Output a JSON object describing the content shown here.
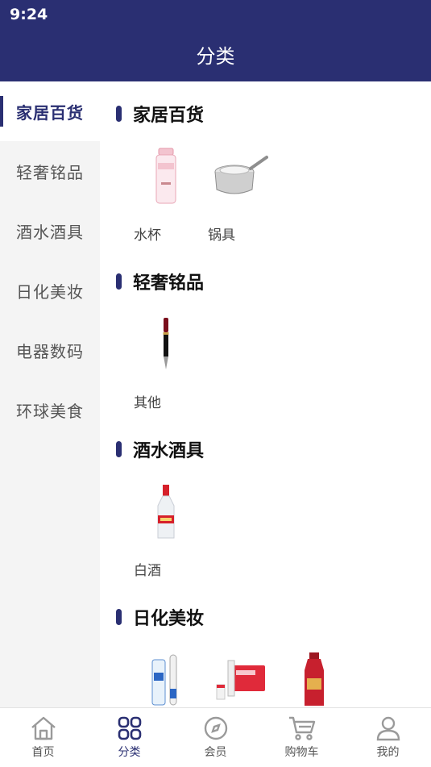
{
  "status_bar": {
    "time": "9:24"
  },
  "header": {
    "title": "分类"
  },
  "sidebar": {
    "items": [
      {
        "label": "家居百货",
        "active": true
      },
      {
        "label": "轻奢铭品",
        "active": false
      },
      {
        "label": "酒水酒具",
        "active": false
      },
      {
        "label": "日化美妆",
        "active": false
      },
      {
        "label": "电器数码",
        "active": false
      },
      {
        "label": "环球美食",
        "active": false
      }
    ]
  },
  "sections": [
    {
      "title": "家居百货",
      "items": [
        {
          "label": "水杯",
          "icon": "water-bottle"
        },
        {
          "label": "锅具",
          "icon": "stainless-pot"
        }
      ]
    },
    {
      "title": "轻奢铭品",
      "items": [
        {
          "label": "其他",
          "icon": "fountain-pen"
        }
      ]
    },
    {
      "title": "酒水酒具",
      "items": [
        {
          "label": "白酒",
          "icon": "liquor-bottle"
        }
      ]
    },
    {
      "title": "日化美妆",
      "items": [
        {
          "label": "",
          "icon": "toothpaste-brush"
        },
        {
          "label": "",
          "icon": "skincare-set"
        },
        {
          "label": "",
          "icon": "shampoo-bottle"
        }
      ]
    }
  ],
  "tabbar": {
    "tabs": [
      {
        "label": "首页",
        "icon": "home-icon",
        "active": false
      },
      {
        "label": "分类",
        "icon": "grid-icon",
        "active": true
      },
      {
        "label": "会员",
        "icon": "compass-icon",
        "active": false
      },
      {
        "label": "购物车",
        "icon": "cart-icon",
        "active": false
      },
      {
        "label": "我的",
        "icon": "user-icon",
        "active": false
      }
    ]
  },
  "colors": {
    "primary": "#2a2f72",
    "sidebar_bg": "#f4f4f4",
    "text": "#555555"
  }
}
